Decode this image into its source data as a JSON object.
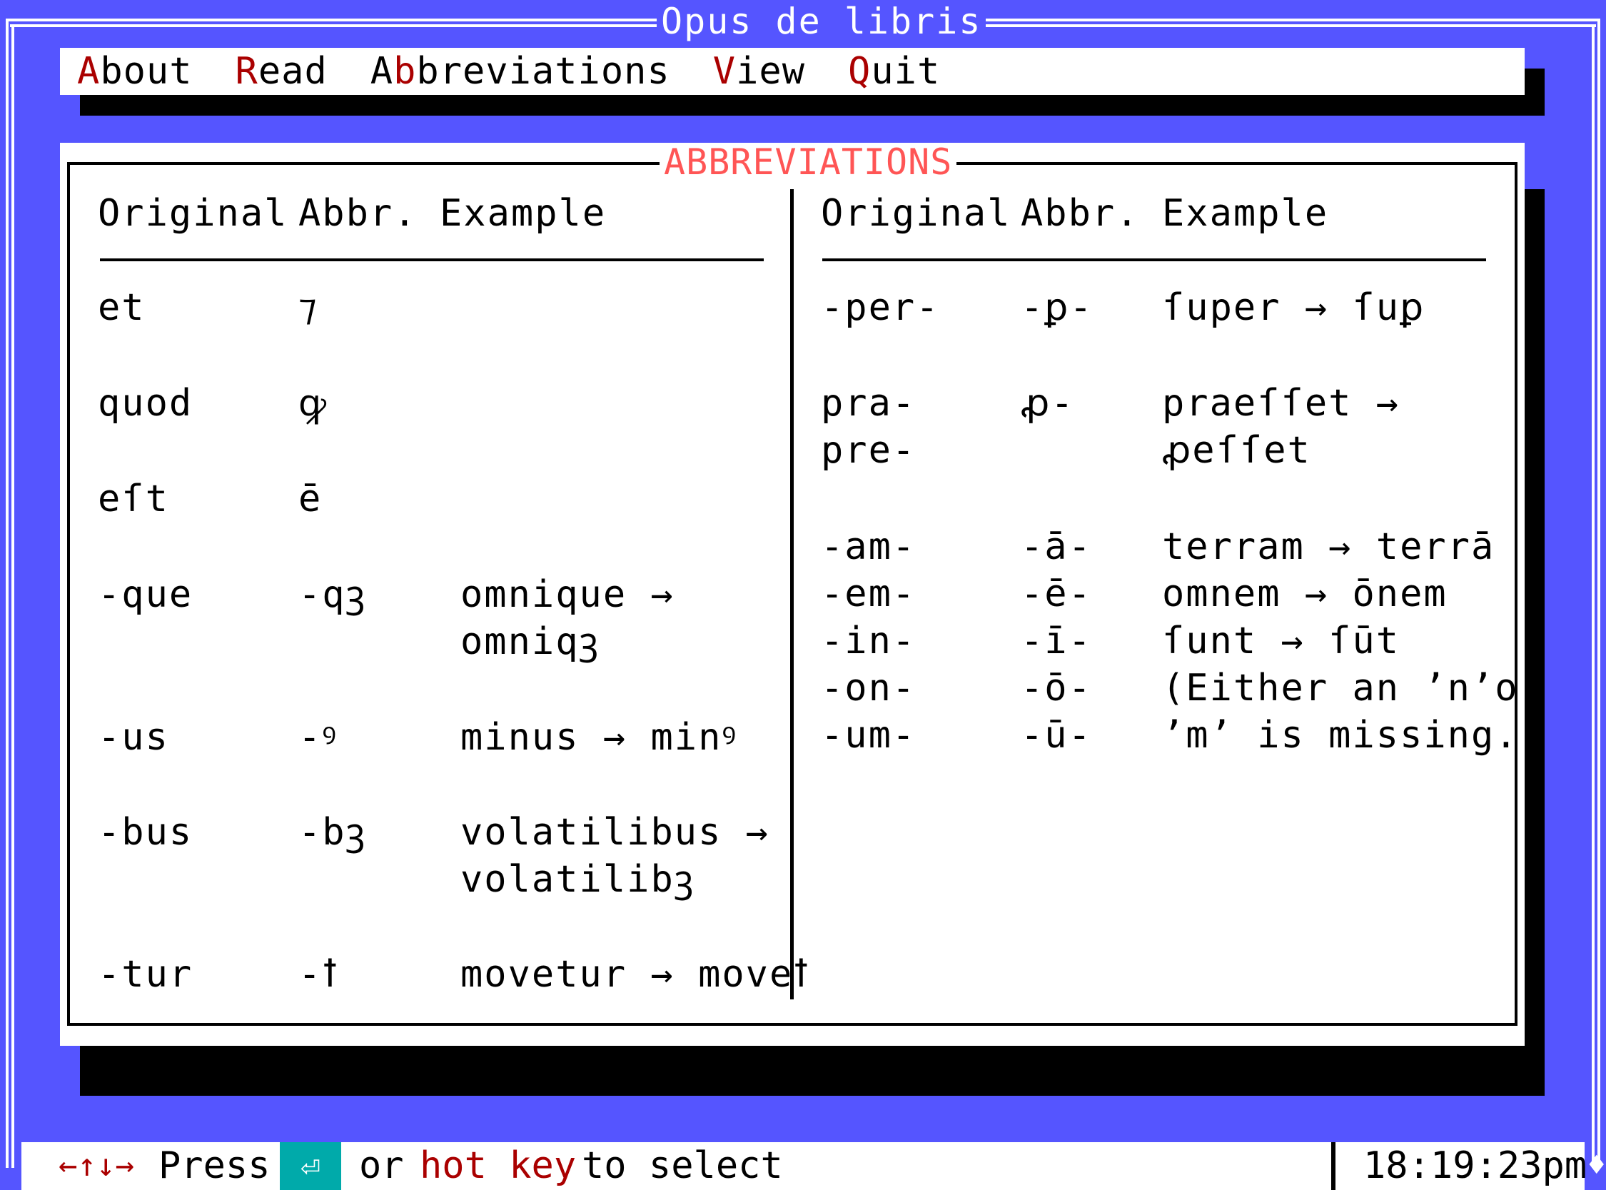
{
  "window": {
    "title": "Opus de libris"
  },
  "menu": [
    {
      "hotkey": "A",
      "rest": "bout"
    },
    {
      "hotkey": "R",
      "rest": "ead"
    },
    {
      "pre": "A",
      "hotkey": "b",
      "rest": "breviations"
    },
    {
      "hotkey": "V",
      "rest": "iew"
    },
    {
      "hotkey": "Q",
      "rest": "uit"
    }
  ],
  "dialog": {
    "title": "ABBREVIATIONS",
    "headers": {
      "original": "Original",
      "abbr": "Abbr.",
      "example": "Example"
    },
    "left": [
      {
        "original": "et",
        "abbr": "⁊",
        "example": ""
      },
      {
        "original": "quod",
        "abbr": "ꝙ",
        "example": ""
      },
      {
        "original": "eſt",
        "abbr": "ē",
        "example": ""
      },
      {
        "original": "-que",
        "abbr": "-qꝫ",
        "example": "omnique →",
        "example2": "omniqꝫ"
      },
      {
        "original": "-us",
        "abbr": "-ꝰ",
        "example": "minus → minꝰ"
      },
      {
        "original": "-bus",
        "abbr": "-bꝫ",
        "example": "volatilibus →",
        "example2": "volatilibꝫ"
      },
      {
        "original": "-tur",
        "abbr": "-ꝉ",
        "example": "movetur → moveꝉ"
      }
    ],
    "right": [
      {
        "original": "-per-",
        "abbr": "-ꝑ-",
        "example": "ſuper → ſuꝑ"
      },
      {
        "original": "pra-",
        "original2": "pre-",
        "abbr": "ꝓ-",
        "example": "praeſſet →",
        "example2": "ꝓeſſet"
      },
      {
        "original": "-am-",
        "abbr": "-ā-",
        "example": "terram → terrā"
      },
      {
        "original": "-em-",
        "abbr": "-ē-",
        "example": "omnem → ōnem"
      },
      {
        "original": "-in-",
        "abbr": "-ī-",
        "example": "ſunt → ſūt"
      },
      {
        "original": "-on-",
        "abbr": "-ō-",
        "example": "(Either an ’n’or"
      },
      {
        "original": "-um-",
        "abbr": "-ū-",
        "example": "’m’ is missing.)"
      }
    ]
  },
  "status": {
    "arrows": "←↑↓→",
    "press": "Press",
    "enter_icon": "enter-key-icon",
    "or": "or",
    "hotkey_text": "hot key",
    "to_select": "to select",
    "time": "18:19:23pm"
  },
  "colors": {
    "background": "#5555ff",
    "hotkey": "#aa0000",
    "title": "#ff5555",
    "enter": "#00aaaa"
  }
}
